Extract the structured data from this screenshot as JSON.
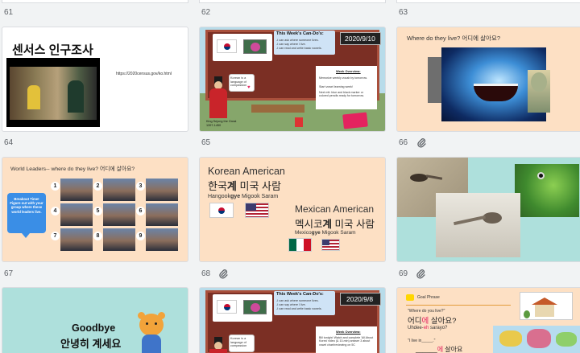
{
  "colors": {
    "peach": "#fde0c4",
    "mint": "#aee0dc",
    "board": "#8c3a2c",
    "sticker_red": "#e4235f",
    "yellow": "#ffd600"
  },
  "row_numbers": [
    "61",
    "62",
    "63",
    "64",
    "65",
    "66",
    "67",
    "68",
    "69"
  ],
  "slide61": {
    "title": "센서스 인구조사",
    "url": "https://2020census.gov/ko.html"
  },
  "slide62": {
    "cando_title": "This Week's Can-Do's:",
    "cando_lines": [
      "-I can ask where someone lives.",
      "-I can say where I live.",
      "-I can read and write basic vowels."
    ],
    "date": "2020/9/10",
    "speech": "Korean is a language of compassion",
    "caption": "King Sejong the Great 1397-1450",
    "overview_title": "Week Overview:",
    "overview_lines": [
      "Memorize weekly vocab by tomorrow.",
      "Start vowel learning week!",
      "Next mtt: blue and black marker or colored pencils ready for tomorrow."
    ]
  },
  "slide63": {
    "title": "Where do they live? 어디에 살아요?"
  },
  "slide64": {
    "title": "World Leaders-- where do they live? 어디에 살아요?",
    "breakout": "Breakout Time! Figure out with your group where these world leaders live.",
    "numbers": [
      "1",
      "2",
      "3",
      "4",
      "5",
      "6",
      "7",
      "8",
      "9"
    ]
  },
  "slide65": {
    "ka_en": "Korean American",
    "ka_kr_pre": "한국",
    "ka_kr_bold": "계",
    "ka_kr_post": " 미국 사람",
    "ka_rom_pre": "Hangook",
    "ka_rom_bold": "gye",
    "ka_rom_post": " Migook Saram",
    "ma_en": "Mexican American",
    "ma_kr_pre": "멕시코",
    "ma_kr_bold": "계",
    "ma_kr_post": " 미국 사람",
    "ma_rom_pre": "Mexico",
    "ma_rom_bold": "gye",
    "ma_rom_post": " Migook Saram"
  },
  "slide67": {
    "title_en": "Goodbye",
    "title_kr": "안녕히 계세요"
  },
  "slide68": {
    "cando_title": "This Week's Can-Do's:",
    "cando_lines": [
      "-I can ask where someone lives.",
      "-I can say where I live.",
      "-I can read and write basic vowels."
    ],
    "date": "2020/9/8",
    "speech": "Korean is a language of compassion",
    "overview_title": "Week Overview:",
    "overview_lines": [
      "Bill tonight: Watch and complete 'All About Korea' video (& 10-min) answer 3 about vowel chart/reviewing on 5C"
    ]
  },
  "slide69": {
    "goal": "Goal Phrase",
    "q_en": "\"Where do you live?\"",
    "q_kr_pre": "어디",
    "q_kr_red": "에",
    "q_kr_post": " 살아요?",
    "q_rom_pre": "Uhdee-",
    "q_rom_red": "eh",
    "q_rom_post": " sarayo?",
    "a_en": "\"I live in_____.\"",
    "a_kr_blank": "______",
    "a_kr_red": "에",
    "a_kr_post": " 살아요"
  }
}
